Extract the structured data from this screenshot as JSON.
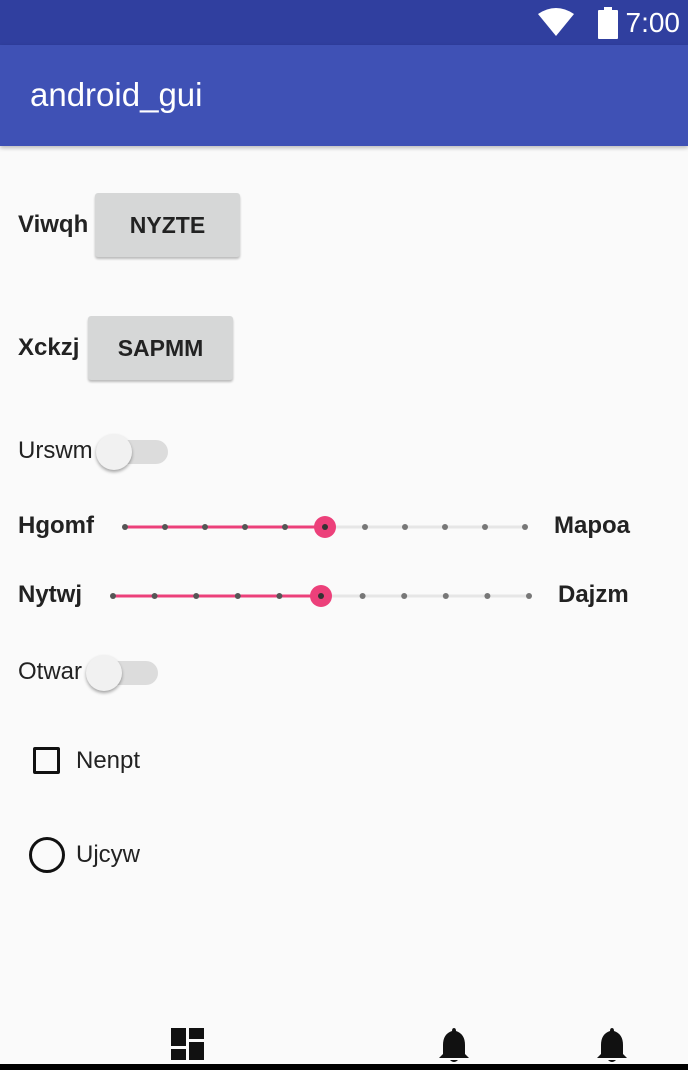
{
  "status_bar": {
    "time": "7:00",
    "wifi_icon": "wifi-icon",
    "battery_icon": "battery-icon"
  },
  "app_bar": {
    "title": "android_gui"
  },
  "form": {
    "row1": {
      "label": "Viwqh",
      "button": "NYZTE"
    },
    "row2": {
      "label": "Xckzj",
      "button": "SAPMM"
    },
    "switch1": {
      "label": "Urswm",
      "checked": false
    },
    "seek1": {
      "left_label": "Hgomf",
      "right_label": "Mapoa",
      "value": 5,
      "max": 10
    },
    "seek2": {
      "left_label": "Nytwj",
      "right_label": "Dajzm",
      "value": 5,
      "max": 10
    },
    "switch2": {
      "label": "Otwar",
      "checked": false
    },
    "checkbox": {
      "label": "Nenpt",
      "checked": false
    },
    "radio": {
      "label": "Ujcyw",
      "checked": false
    }
  },
  "bottom_nav": {
    "icons": [
      "dashboard-icon",
      "notifications-icon",
      "notifications-icon"
    ]
  },
  "colors": {
    "status_bar": "#303f9f",
    "app_bar": "#3f51b5",
    "accent": "#ec407a"
  }
}
